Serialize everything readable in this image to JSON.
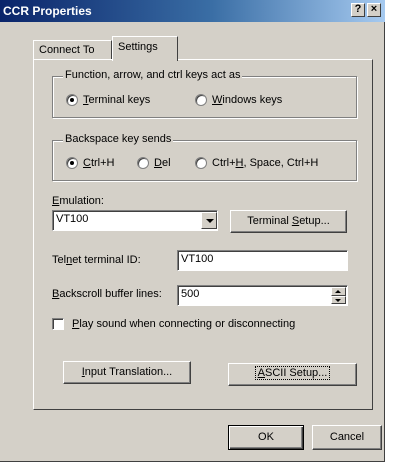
{
  "window": {
    "title": "CCR Properties",
    "help_glyph": "?",
    "close_glyph": "×"
  },
  "tabs": [
    {
      "label": "Connect To",
      "selected": false
    },
    {
      "label": "Settings",
      "selected": true
    }
  ],
  "keys_group": {
    "legend": "Function, arrow, and ctrl keys act as",
    "options": [
      {
        "mnemonic": "T",
        "rest": "erminal keys",
        "checked": true
      },
      {
        "mnemonic": "W",
        "rest": "indows keys",
        "checked": false
      }
    ]
  },
  "backspace_group": {
    "legend": "Backspace key sends",
    "options": [
      {
        "mnemonic": "C",
        "rest": "trl+H",
        "checked": true
      },
      {
        "mnemonic": "D",
        "rest": "el",
        "checked": false
      },
      {
        "pre": "Ctrl+",
        "mnemonic": "H",
        "rest": ", Space, Ctrl+H",
        "checked": false
      }
    ]
  },
  "emulation": {
    "label_mnemonic": "E",
    "label_rest": "mulation:",
    "value": "VT100",
    "setup_button_pre": "Terminal ",
    "setup_button_mnemonic": "S",
    "setup_button_rest": "etup..."
  },
  "telnet": {
    "label_pre": "Tel",
    "label_mnemonic": "n",
    "label_rest": "et terminal ID:",
    "value": "VT100"
  },
  "backscroll": {
    "label_mnemonic": "B",
    "label_rest": "ackscroll buffer lines:",
    "value": "500"
  },
  "play_sound": {
    "mnemonic": "P",
    "rest": "lay sound when connecting or disconnecting",
    "checked": false
  },
  "buttons": {
    "input_translation_mnemonic": "I",
    "input_translation_rest": "nput Translation...",
    "ascii_setup_mnemonic": "A",
    "ascii_setup_rest": "SCII Setup...",
    "ok": "OK",
    "cancel": "Cancel"
  }
}
